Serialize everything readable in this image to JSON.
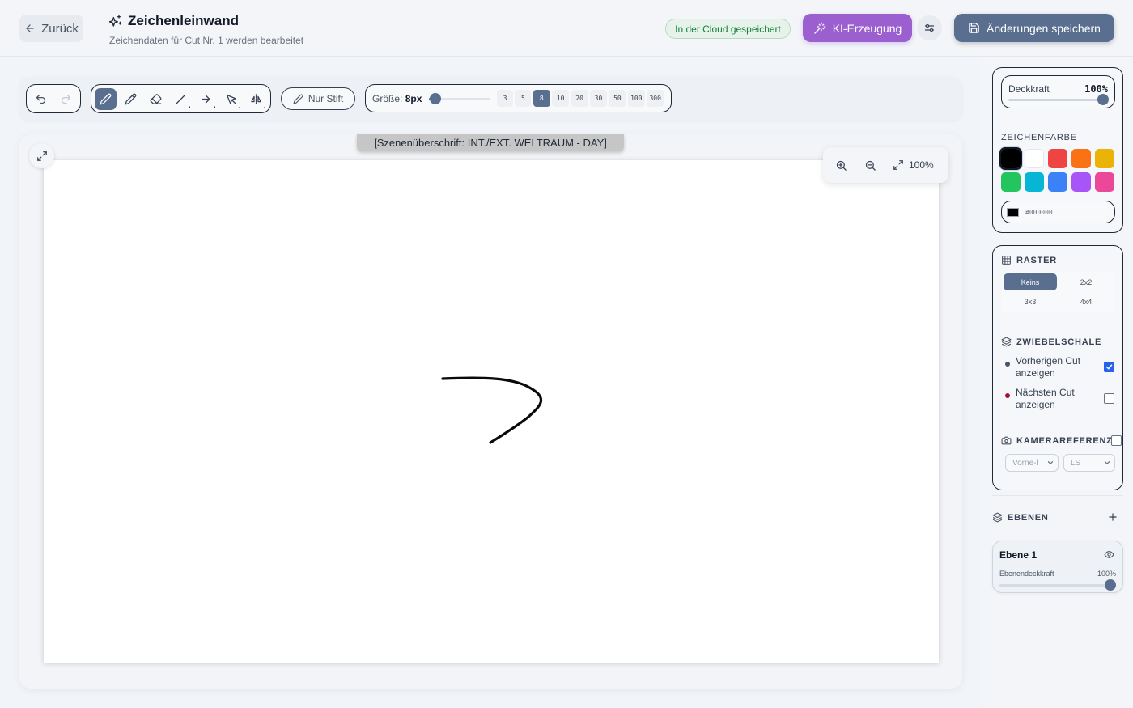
{
  "header": {
    "back_label": "Zurück",
    "title": "Zeichenleinwand",
    "subtitle": "Zeichendaten für Cut Nr. 1 werden bearbeitet",
    "cloud_status": "In der Cloud gespeichert",
    "ki_label": "KI-Erzeugung",
    "save_label": "Änderungen speichern"
  },
  "toolbar": {
    "tools": [
      "undo",
      "redo",
      "brush",
      "pencil",
      "eraser",
      "line",
      "arrow",
      "select",
      "mirror"
    ],
    "active_tool": "brush",
    "pen_only_label": "Nur Stift",
    "size_label": "Größe:",
    "size_value": "8px",
    "size_slider_fraction": 0.02,
    "size_presets": [
      "3",
      "5",
      "8",
      "10",
      "20",
      "30",
      "50",
      "100",
      "300"
    ],
    "active_size": "8"
  },
  "canvas": {
    "scene_heading": "[Szenenüberschrift: INT./EXT. WELTRAUM - DAY]",
    "zoom_label": "100%"
  },
  "sidebar": {
    "opacity": {
      "label": "Deckkraft",
      "value": "100%",
      "fraction": 1.0
    },
    "color_heading": "ZEICHENFARBE",
    "colors": [
      "#000000",
      "#ffffff",
      "#ef4444",
      "#f97316",
      "#eab308",
      "#22c55e",
      "#06b6d4",
      "#3b82f6",
      "#a855f7",
      "#ec4899"
    ],
    "selected_color": "#000000",
    "hex_value": "#000000",
    "raster_heading": "RASTER",
    "grid_options": [
      "Keins",
      "2x2",
      "3x3",
      "4x4"
    ],
    "active_grid": "Keins",
    "onion_heading": "ZWIEBELSCHALE",
    "onion_prev_label": "Vorherigen Cut anzeigen",
    "onion_prev_checked": true,
    "onion_prev_color": "#475569",
    "onion_next_label": "Nächsten Cut anzeigen",
    "onion_next_checked": false,
    "onion_next_color": "#9f1239",
    "camera_heading": "KAMERAREFERENZ",
    "camera_checked": false,
    "camera_select_1": "Vorne-l",
    "camera_select_2": "LS",
    "layers_heading": "EBENEN",
    "layers": [
      {
        "name": "Ebene 1",
        "opacity_label": "Ebenendeckkraft",
        "opacity_value": "100%",
        "fraction": 1.0
      }
    ]
  },
  "colors": {
    "accent": "#5a6e90",
    "ki_purple": "#9b5fd0",
    "cloud_green": "#15803d"
  }
}
